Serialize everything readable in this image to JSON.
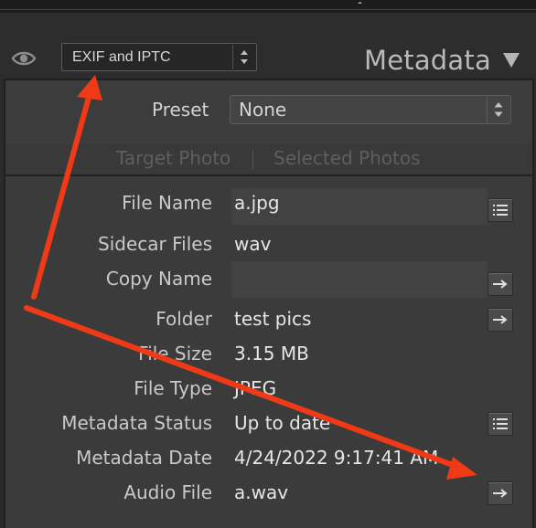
{
  "header": {
    "preset_dropdown_value": "EXIF and IPTC",
    "title": "Metadata"
  },
  "preset": {
    "label": "Preset",
    "value": "None"
  },
  "tabs": [
    {
      "label": "Target Photo"
    },
    {
      "label": "Selected Photos"
    }
  ],
  "fields": [
    {
      "label": "File Name",
      "value": "a.jpg"
    },
    {
      "label": "Sidecar Files",
      "value": "wav"
    },
    {
      "label": "Copy Name",
      "value": ""
    },
    {
      "label": "Folder",
      "value": "test pics"
    },
    {
      "label": "File Size",
      "value": "3.15 MB"
    },
    {
      "label": "File Type",
      "value": "JPEG"
    },
    {
      "label": "Metadata Status",
      "value": "Up to date"
    },
    {
      "label": "Metadata Date",
      "value": "4/24/2022 9:17:41 AM"
    },
    {
      "label": "Audio File",
      "value": "a.wav"
    }
  ],
  "icons": {
    "visibility": "eye-icon",
    "collapse": "triangle-down-icon",
    "list": "list-icon",
    "go_to": "arrow-right-icon",
    "spinner": "up-down-spinner-icon"
  },
  "colors": {
    "annotation": "#f03a17",
    "panel_bg": "#3b3b3b",
    "header_bg": "#2d2d2d",
    "disabled_tab_text": "#5e5e5e"
  }
}
